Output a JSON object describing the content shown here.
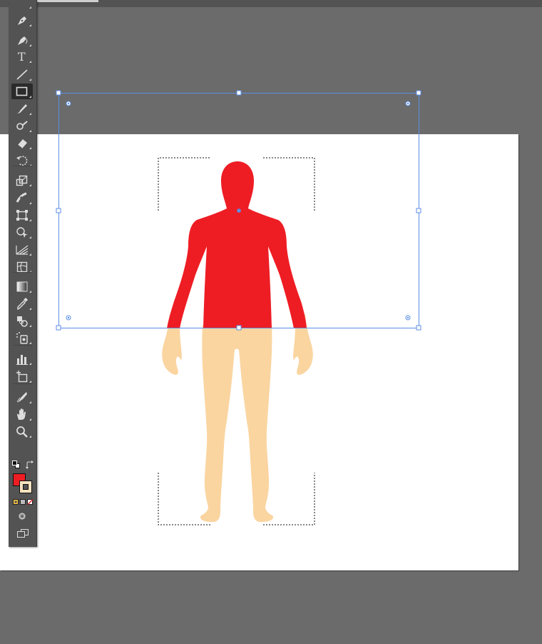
{
  "colors": {
    "workspace": "#6b6b6b",
    "artboard": "#ffffff",
    "selection": "#5b8ee6",
    "shirt": "#ee1d24",
    "skin": "#fad5a0",
    "stroke_swatch": "#f7e3c0",
    "toolbar": "#535353"
  },
  "toolbar": {
    "tools": [
      {
        "name": "lasso-tool-icon"
      },
      {
        "name": "pen-tool-icon"
      },
      {
        "name": "curvature-tool-icon"
      },
      {
        "name": "type-tool-icon",
        "glyph": "T"
      },
      {
        "name": "line-segment-tool-icon"
      },
      {
        "name": "rectangle-tool-icon",
        "active": true
      },
      {
        "name": "paintbrush-tool-icon"
      },
      {
        "name": "shaper-tool-icon"
      },
      {
        "name": "eraser-tool-icon"
      },
      {
        "name": "rotate-tool-icon"
      },
      {
        "name": "scale-tool-icon"
      },
      {
        "name": "width-tool-icon"
      },
      {
        "name": "free-transform-tool-icon"
      },
      {
        "name": "shape-builder-tool-icon"
      },
      {
        "name": "perspective-grid-tool-icon"
      },
      {
        "name": "mesh-tool-icon"
      },
      {
        "name": "gradient-tool-icon"
      },
      {
        "name": "eyedropper-tool-icon"
      },
      {
        "name": "blend-tool-icon"
      },
      {
        "name": "symbol-sprayer-tool-icon"
      },
      {
        "name": "column-graph-tool-icon"
      },
      {
        "name": "artboard-tool-icon"
      },
      {
        "name": "slice-tool-icon"
      },
      {
        "name": "hand-tool-icon"
      },
      {
        "name": "zoom-tool-icon"
      }
    ],
    "fill_color": "#ee1d24",
    "stroke_color": "#f7e3c0"
  }
}
